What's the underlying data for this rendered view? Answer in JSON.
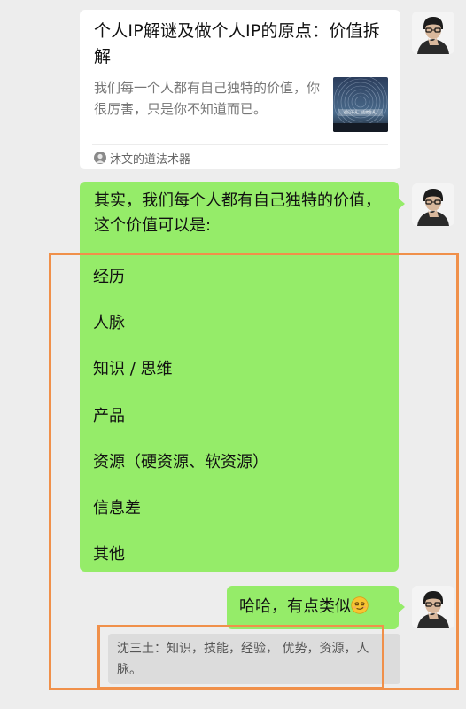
{
  "card": {
    "title": "个人IP解谜及做个人IP的原点：价值拆解",
    "description": "我们每一个人都有自己独特的价值，你很厉害，只是你不知道而已。",
    "thumbnail_text": "遇见不凡，成就非凡。",
    "source": "沐文的道法术器"
  },
  "message_value": {
    "intro": "其实，我们每个人都有自己独特的价值，这个价值可以是:",
    "items": [
      "经历",
      "人脉",
      "知识 / 思维",
      "产品",
      "资源（硬资源、软资源）",
      "信息差",
      "其他"
    ]
  },
  "message_reply": {
    "text": "哈哈，有点类似",
    "emoji": "smirk-emoji"
  },
  "quote": {
    "text": "沈三土：知识，技能，经验， 优势，资源，人脉。"
  },
  "colors": {
    "chat_background": "#ededed",
    "bubble_green": "#95ec69",
    "card_white": "#ffffff",
    "quote_gray": "#dcdcdc",
    "highlight_orange": "#f0904a"
  }
}
